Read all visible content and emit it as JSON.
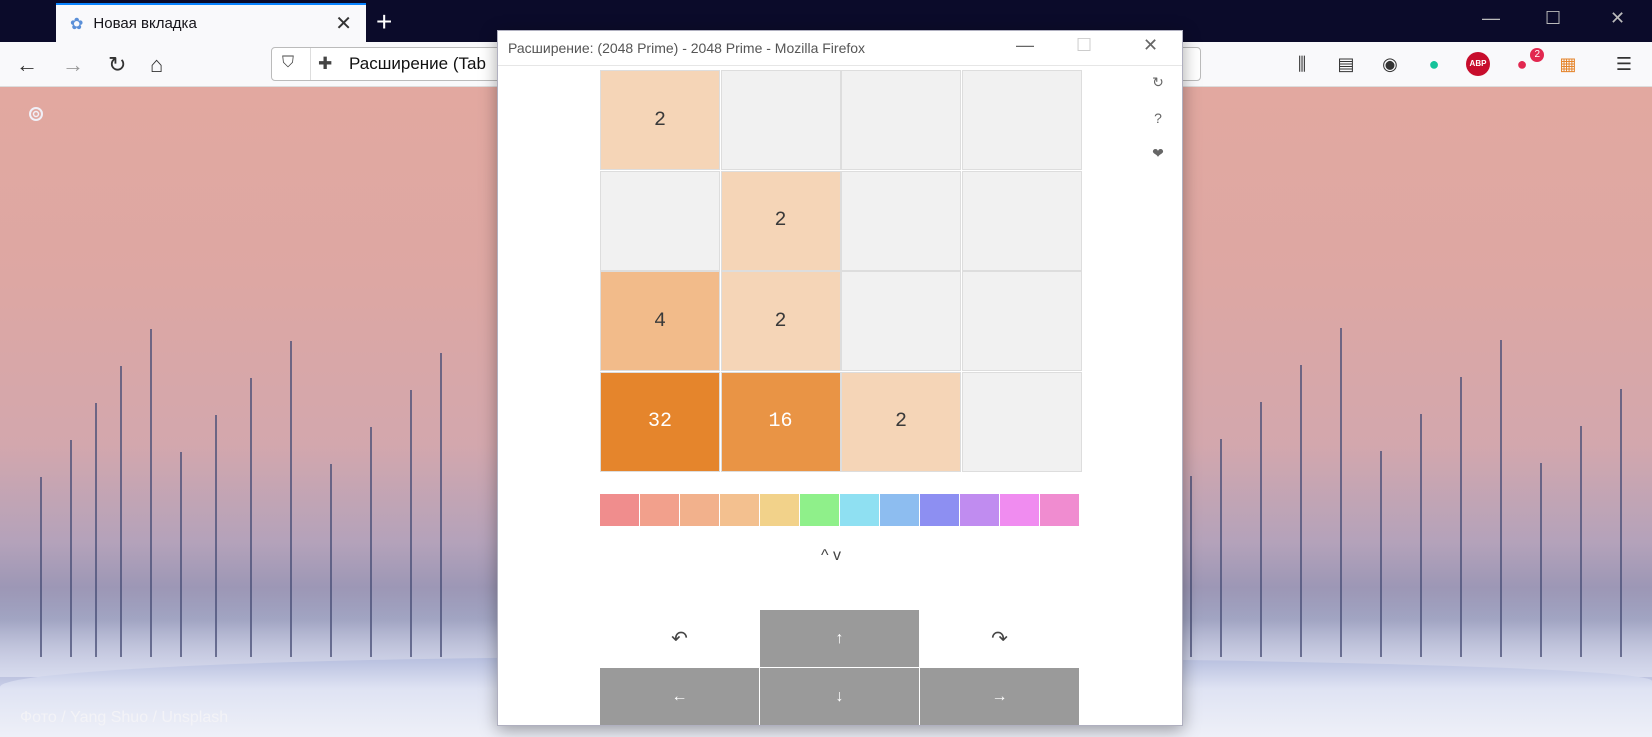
{
  "browser": {
    "tab_title": "Новая вкладка",
    "tab_close": "✕",
    "new_tab": "+",
    "url_text": "Расширение (Tab",
    "window_controls": {
      "minimize": "—",
      "maximize": "☐",
      "close": "✕"
    },
    "badges": {
      "adblock": "ABP",
      "extension_count": "2"
    }
  },
  "newtab_page": {
    "photo_credit": "Фото / Yang Shuo / Unsplash"
  },
  "popup": {
    "title": "Расширение: (2048 Prime) - 2048 Prime - Mozilla Firefox",
    "controls": {
      "minimize": "—",
      "maximize": "☐",
      "close": "✕"
    },
    "side_icons": {
      "restart": "↻",
      "help": "?",
      "favorite": "❤"
    },
    "board": [
      [
        "2",
        "",
        "",
        ""
      ],
      [
        "",
        "2",
        "",
        ""
      ],
      [
        "4",
        "2",
        "",
        ""
      ],
      [
        "32",
        "16",
        "2",
        ""
      ]
    ],
    "tile_colors": {
      "empty": "#f1f1f1",
      "2": "#f5d5b7",
      "4": "#f2bb8a",
      "16": "#e99445",
      "32": "#e5852c"
    },
    "palette": [
      "#f08d8d",
      "#f2a08c",
      "#f2b18c",
      "#f3c08f",
      "#f2d28a",
      "#8ff08a",
      "#8fe0f2",
      "#8dbdf0",
      "#8d8ff2",
      "#c08cf0",
      "#f08cf0",
      "#f08cd0"
    ],
    "palette_arrows": "^ v",
    "controls_pad": {
      "undo": "↶",
      "up": "↑",
      "redo": "↷",
      "left": "←",
      "down": "↓",
      "right": "→"
    }
  }
}
